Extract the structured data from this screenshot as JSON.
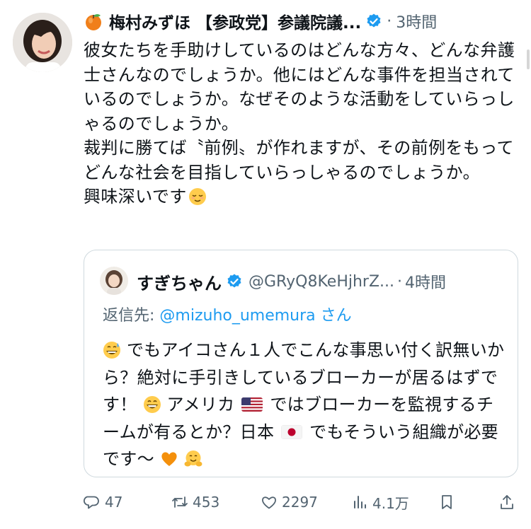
{
  "tweet": {
    "author": {
      "name": "梅村みずほ 【参政党】参議院議...",
      "time_sep": "·",
      "time": "3時間"
    },
    "paragraphs": [
      "彼女たちを手助けしているのはどんな方々、どんな弁護士さんなのでしょうか。他にはどんな事件を担当されているのでしょうか。なぜそのような活動をしていらっしゃるのでしょうか。",
      "裁判に勝てば〝前例〟が作れますが、その前例をもってどんな社会を目指していらっしゃるのでしょうか。",
      "興味深いです"
    ]
  },
  "quote": {
    "name": "すぎちゃん",
    "handle": "@GRyQ8KeHjhrZ...",
    "time_sep": "·",
    "time": "4時間",
    "reply_prefix": "返信先: ",
    "reply_mention": "@mizuho_umemura",
    "reply_suffix": " さん",
    "text": {
      "s1": "でもアイコさん１人でこんな事思い付く訳無いから？絶対に手引きしているブローカーが居るはずです！",
      "s2": "アメリカ",
      "s3": "ではブローカーを監視するチームが有るとか？日本",
      "s4": "でもそういう組織が必要です〜"
    }
  },
  "actions": {
    "replies": "47",
    "retweets": "453",
    "likes": "2297",
    "views": "4.1万"
  },
  "icons": {
    "header_emoji": "peach-emoji-icon",
    "verified": "verified-badge-icon",
    "reply": "reply-icon",
    "retweet": "retweet-icon",
    "like": "heart-icon",
    "views": "views-icon",
    "bookmark": "bookmark-icon",
    "share": "share-icon"
  },
  "colors": {
    "text": "#0f1419",
    "secondary": "#536471",
    "link": "#1d9bf0",
    "border": "#cfd9de"
  }
}
